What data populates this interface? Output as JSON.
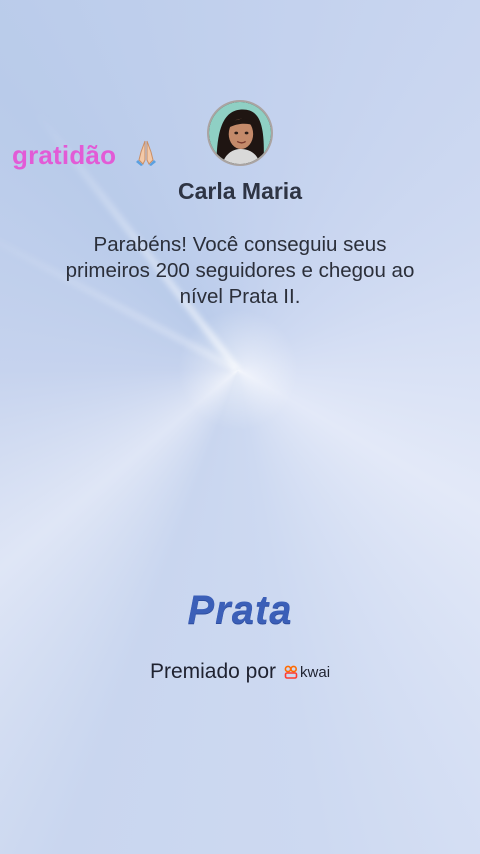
{
  "sticker": {
    "text": "gratidão",
    "emoji_icon": "folded-hands-icon"
  },
  "profile": {
    "name": "Carla Maria",
    "avatar_icon": "avatar-photo"
  },
  "message": "Parabéns! Você conseguiu seus primeiros 200 seguidores e chegou ao nível Prata II.",
  "level": {
    "label": "Prata",
    "color": "#3b5fb8"
  },
  "footer": {
    "awarded_by": "Premiado por",
    "brand": "kwai",
    "brand_color": "#ff6a00"
  },
  "colors": {
    "sticker": "#e25bd6",
    "background": "#c9d6ef"
  }
}
